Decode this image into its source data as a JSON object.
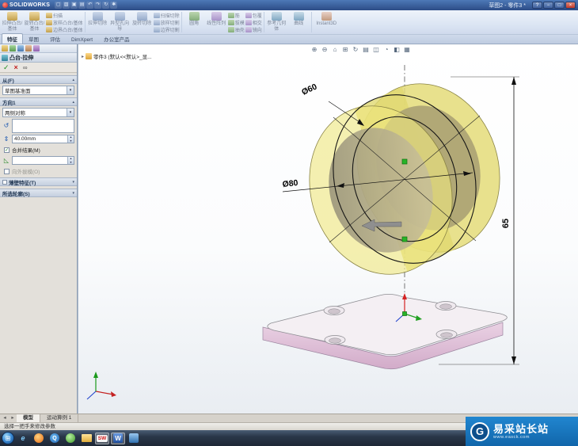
{
  "titlebar": {
    "brand": "SOLIDWORKS",
    "title": "草图2 - 零件3 *"
  },
  "ribbon": {
    "extrude_boss": "拉伸凸台/基体",
    "revolve_boss": "旋转凸台/基体",
    "sweep": "扫描",
    "loft": "放样凸台/基体",
    "boundary_boss": "边界凸台/基体",
    "extrude_cut": "拉伸切除",
    "hole_wizard": "异型孔向导",
    "revolve_cut": "旋转切除",
    "sweep_cut": "扫描切除",
    "loft_cut": "放样切割",
    "boundary_cut": "边界切割",
    "fillet": "圆角",
    "linear_pattern": "线性阵列",
    "rib": "筋",
    "draft": "拔模",
    "shell": "抽壳",
    "wrap": "包覆",
    "intersect": "相交",
    "mirror": "镜向",
    "ref_geometry": "参考几何体",
    "curves": "曲线",
    "instant3d": "Instant3D"
  },
  "tabs": {
    "features": "特征",
    "sketch": "草图",
    "evaluate": "评估",
    "dimxpert": "DimXpert",
    "office": "办公室产品"
  },
  "panel": {
    "title": "凸台-拉伸",
    "from_header": "从(F)",
    "from_value": "草图基准面",
    "dir1_header": "方向1",
    "dir1_value": "两侧对称",
    "depth_value": "40.00mm",
    "merge_label": "合并结果(M)",
    "outward_draft_label": "向外拔模(O)",
    "thin_header": "薄壁特征(T)",
    "contours_header": "所选轮廓(S)"
  },
  "viewport": {
    "tree_flyout": "零件3 (默认<<默认>_显...",
    "dim_d60": "Ø60",
    "dim_d80": "Ø80",
    "dim_h65": "65"
  },
  "model_tabs": {
    "model": "模型",
    "motion": "运动算例 1"
  },
  "status": {
    "message": "选择一把手来修改参数"
  },
  "watermark": {
    "name": "易采站长站",
    "sub": "www.easck.com"
  },
  "icons": {
    "window_help": "?",
    "window_min": "−",
    "window_max": "□",
    "window_close": "×",
    "qat_new": "▢",
    "qat_open": "▧",
    "qat_save": "▣",
    "qat_print": "▤",
    "qat_undo": "↶",
    "qat_redo": "↷",
    "qat_rebuild": "↻",
    "qat_options": "✱",
    "ok": "✓",
    "cancel": "×",
    "preview_glasses": "∞",
    "reverse_direction": "↺",
    "depth": "⇕",
    "draft": "◺",
    "check": "✓",
    "chev_up": "▴",
    "chev_down": "▾",
    "dropdown": "▾",
    "spin_up": "▴",
    "spin_down": "▾",
    "flyout_arrow": "▸",
    "vt_zoom_in": "⊕",
    "vt_zoom_out": "⊖",
    "vt_zoom_fit": "⌂",
    "vt_zoom_area": "⊞",
    "vt_rotate": "↻",
    "vt_display_style": "▤",
    "vt_section": "◫",
    "vt_hide_show": "◔",
    "vt_appearance": "◧",
    "vt_orientation": "▦",
    "nav_prev": "◂",
    "nav_next": "▸",
    "start": "⊞",
    "ie": "e",
    "qq": "Q",
    "sw": "SW",
    "word": "W"
  },
  "colors": {
    "titlebar_blue": "#2c4c86",
    "preview_yellow": "#e8e070",
    "plate_pink": "#dfc3da",
    "handle_green": "#27b427",
    "watermark_blue": "#1878be"
  }
}
